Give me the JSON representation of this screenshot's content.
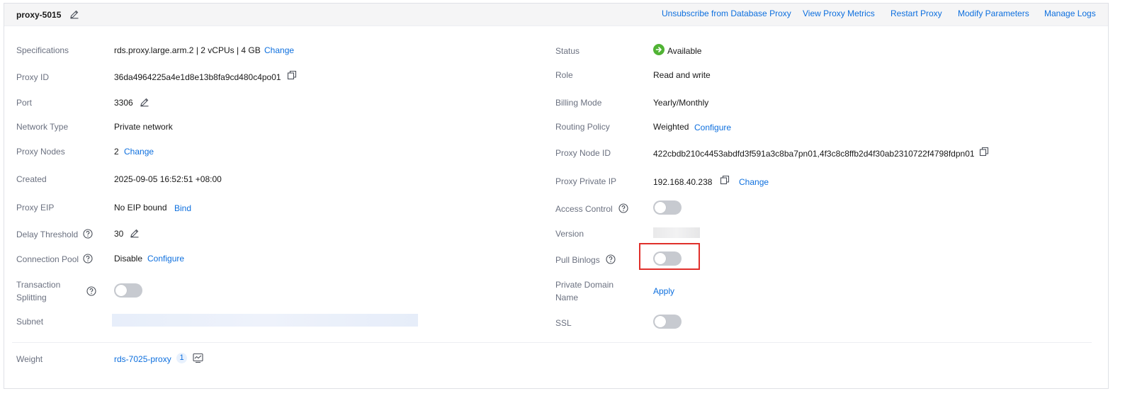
{
  "header": {
    "title": "proxy-5015",
    "actions": [
      "Unsubscribe from Database Proxy",
      "View Proxy Metrics",
      "Restart Proxy",
      "Modify Parameters",
      "Manage Logs"
    ]
  },
  "left": {
    "specifications": {
      "label": "Specifications",
      "value": "rds.proxy.large.arm.2 | 2 vCPUs | 4 GB",
      "action": "Change"
    },
    "proxy_id": {
      "label": "Proxy ID",
      "value": "36da4964225a4e1d8e13b8fa9cd480c4po01"
    },
    "port": {
      "label": "Port",
      "value": "3306"
    },
    "network_type": {
      "label": "Network Type",
      "value": "Private network"
    },
    "proxy_nodes": {
      "label": "Proxy Nodes",
      "value": "2",
      "action": "Change"
    },
    "created": {
      "label": "Created",
      "value": "2025-09-05 16:52:51 +08:00"
    },
    "proxy_eip": {
      "label": "Proxy EIP",
      "value": "No EIP bound",
      "action": "Bind"
    },
    "delay_threshold": {
      "label": "Delay Threshold",
      "value": "30"
    },
    "connection_pool": {
      "label": "Connection Pool",
      "value": "Disable",
      "action": "Configure"
    },
    "transaction_splitting": {
      "label_line1": "Transaction",
      "label_line2": "Splitting",
      "enabled": false
    },
    "subnet": {
      "label": "Subnet"
    }
  },
  "right": {
    "status": {
      "label": "Status",
      "value": "Available",
      "color": "#50b334"
    },
    "role": {
      "label": "Role",
      "value": "Read and write"
    },
    "billing_mode": {
      "label": "Billing Mode",
      "value": "Yearly/Monthly"
    },
    "routing_policy": {
      "label": "Routing Policy",
      "value": "Weighted",
      "action": "Configure"
    },
    "proxy_node_id": {
      "label": "Proxy Node ID",
      "value": "422cbdb210c4453abdfd3f591a3c8ba7pn01,4f3c8c8ffb2d4f30ab2310722f4798fdpn01"
    },
    "proxy_private_ip": {
      "label": "Proxy Private IP",
      "value": "192.168.40.238",
      "action": "Change"
    },
    "access_control": {
      "label": "Access Control",
      "enabled": false
    },
    "version": {
      "label": "Version"
    },
    "pull_binlogs": {
      "label": "Pull Binlogs",
      "enabled": false
    },
    "private_domain_name": {
      "label_line1": "Private Domain",
      "label_line2": "Name",
      "action": "Apply"
    },
    "ssl": {
      "label": "SSL",
      "enabled": false
    }
  },
  "weight": {
    "label": "Weight",
    "instance": "rds-7025-proxy",
    "count": "1"
  },
  "colors": {
    "link": "#0d6fde",
    "highlight": "#e0302b",
    "toggle_off": "#c7cad0"
  }
}
